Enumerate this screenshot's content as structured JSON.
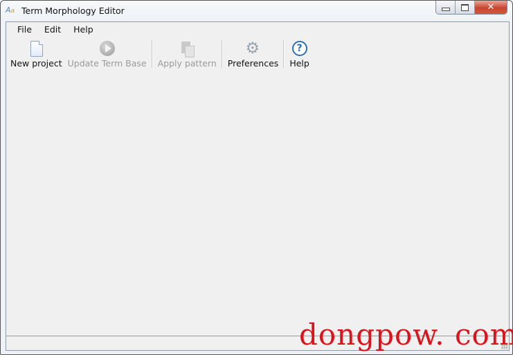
{
  "window": {
    "title": "Term Morphology Editor",
    "app_icon": "aa-script-icon",
    "controls": {
      "minimize": "minimize-icon",
      "maximize": "maximize-icon",
      "close": "close-icon",
      "close_glyph": "✕"
    }
  },
  "menubar": {
    "items": [
      {
        "label": "File"
      },
      {
        "label": "Edit"
      },
      {
        "label": "Help"
      }
    ]
  },
  "toolbar": {
    "items": [
      {
        "label": "New project",
        "icon": "new-document-icon",
        "enabled": true
      },
      {
        "label": "Update Term Base",
        "icon": "play-icon",
        "enabled": false
      },
      {
        "label": "Apply pattern",
        "icon": "paste-icon",
        "enabled": false
      },
      {
        "label": "Preferences",
        "icon": "gear-icon",
        "enabled": true
      },
      {
        "label": "Help",
        "icon": "help-icon",
        "enabled": true
      }
    ],
    "help_glyph": "?",
    "gear_glyph": "⚙"
  },
  "statusbar": {
    "text": ""
  },
  "watermark": {
    "text": "dongpow. com",
    "color": "#d9141c"
  }
}
